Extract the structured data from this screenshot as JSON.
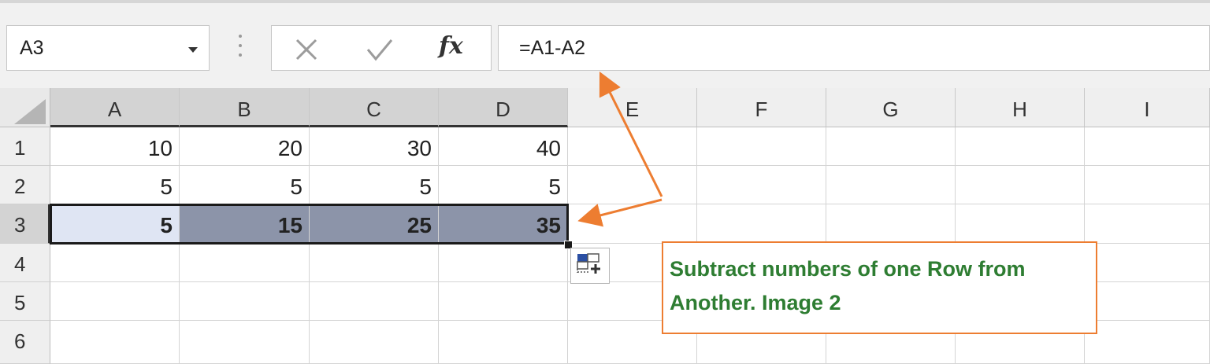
{
  "name_box": {
    "value": "A3"
  },
  "formula_bar": {
    "fx_label": "fx",
    "formula": "=A1-A2"
  },
  "columns": [
    "A",
    "B",
    "C",
    "D",
    "E",
    "F",
    "G",
    "H",
    "I"
  ],
  "rows": [
    {
      "label": "1",
      "cells": [
        "10",
        "20",
        "30",
        "40"
      ]
    },
    {
      "label": "2",
      "cells": [
        "5",
        "5",
        "5",
        "5"
      ]
    },
    {
      "label": "3",
      "cells": [
        "5",
        "15",
        "25",
        "35"
      ]
    },
    {
      "label": "4",
      "cells": []
    },
    {
      "label": "5",
      "cells": []
    },
    {
      "label": "6",
      "cells": []
    }
  ],
  "callout": {
    "line1": "Subtract numbers of one Row from",
    "line2": "Another. Image 2"
  },
  "colors": {
    "accent_orange": "#ed7d31",
    "callout_text": "#2e7d32",
    "selection_fill": "#8c94a9",
    "active_cell_fill": "#dfe5f3"
  },
  "icons": {
    "cancel": "x-icon",
    "enter": "check-icon",
    "quick_analysis": "quick-analysis-icon"
  }
}
